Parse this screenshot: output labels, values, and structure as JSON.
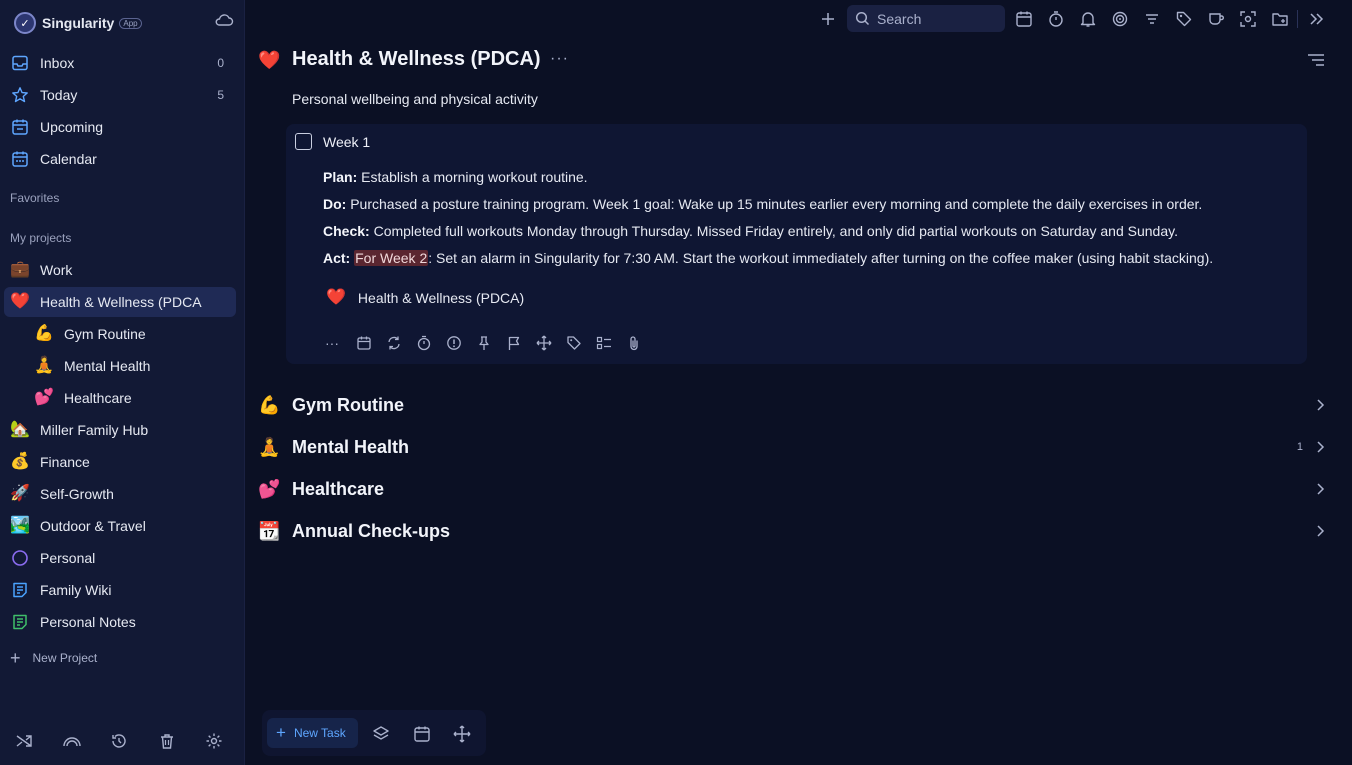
{
  "app": {
    "name": "Singularity",
    "badge": "App"
  },
  "sidebar": {
    "nav": [
      {
        "label": "Inbox",
        "count": "0",
        "icon": "inbox-icon"
      },
      {
        "label": "Today",
        "count": "5",
        "icon": "star-icon"
      },
      {
        "label": "Upcoming",
        "count": "",
        "icon": "calendar-upcoming-icon"
      },
      {
        "label": "Calendar",
        "count": "",
        "icon": "calendar-icon"
      }
    ],
    "favorites_label": "Favorites",
    "projects_label": "My projects",
    "projects": [
      {
        "label": "Work",
        "emoji": "💼"
      },
      {
        "label": "Health & Wellness (PDCA",
        "emoji": "❤️"
      },
      {
        "label": "Gym Routine",
        "emoji": "💪"
      },
      {
        "label": "Mental Health",
        "emoji": "🧘"
      },
      {
        "label": "Healthcare",
        "emoji": "💕"
      },
      {
        "label": "Miller Family Hub",
        "emoji": "🏡"
      },
      {
        "label": "Finance",
        "emoji": "💰"
      },
      {
        "label": "Self-Growth",
        "emoji": "🚀"
      },
      {
        "label": "Outdoor & Travel",
        "emoji": "🏞️"
      },
      {
        "label": "Personal",
        "emoji": ""
      },
      {
        "label": "Family Wiki",
        "emoji": ""
      },
      {
        "label": "Personal Notes",
        "emoji": ""
      }
    ],
    "new_project": "New Project"
  },
  "topbar": {
    "search_placeholder": "Search"
  },
  "page": {
    "emoji": "❤️",
    "title": "Health & Wellness (PDCA)",
    "more": "···",
    "description": "Personal wellbeing and physical activity"
  },
  "task": {
    "title": "Week 1",
    "notes": {
      "plan_label": "Plan:",
      "plan_text": " Establish a morning workout routine.",
      "do_label": "Do:",
      "do_text": " Purchased a posture training program. Week 1 goal: Wake up 15 minutes earlier every morning and complete the daily exercises in order.",
      "check_label": "Check:",
      "check_text": " Completed full workouts Monday through Thursday. Missed Friday entirely, and only did partial workouts on Saturday and Sunday.",
      "act_label": "Act:",
      "act_highlight": "For Week 2",
      "act_text": ": Set an alarm in Singularity for 7:30 AM. Start the workout immediately after turning on the coffee maker (using habit stacking)."
    },
    "project_emoji": "❤️",
    "project_name": "Health & Wellness (PDCA)",
    "more": "···"
  },
  "groups": [
    {
      "emoji": "💪",
      "title": "Gym Routine",
      "count": ""
    },
    {
      "emoji": "🧘",
      "title": "Mental Health",
      "count": "1"
    },
    {
      "emoji": "💕",
      "title": "Healthcare",
      "count": ""
    },
    {
      "emoji": "📆",
      "title": "Annual Check-ups",
      "count": ""
    }
  ],
  "bottom": {
    "new_task": "New Task"
  },
  "colors": {
    "accent": "#5ea6ff",
    "background": "#0b1024",
    "sidebar": "#121935",
    "highlight": "#5a2630"
  }
}
